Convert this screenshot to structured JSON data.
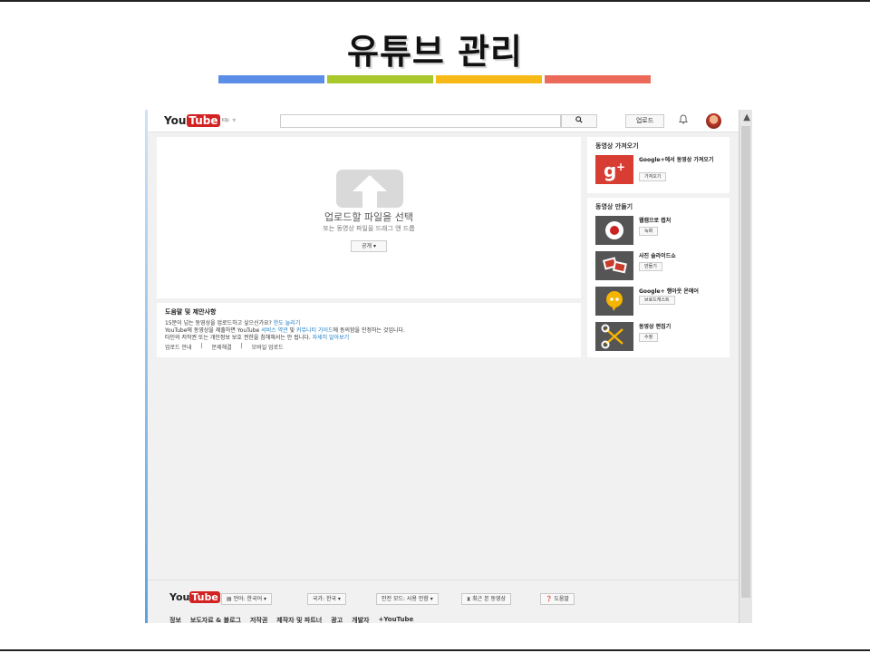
{
  "slide": {
    "title": "유튜브 관리",
    "bar_colors": [
      "#5b8ee6",
      "#a8c82c",
      "#f6b916",
      "#ec6a5a"
    ]
  },
  "masthead": {
    "logo_you": "You",
    "logo_tube": "Tube",
    "logo_region": "KR",
    "search_icon": "search-icon",
    "upload_label": "업로드"
  },
  "upload": {
    "title": "업로드할 파일을 선택",
    "subtitle": "또는 동영상 파일을 드래그 앤 드롭",
    "privacy_label": "공개 ▾"
  },
  "help": {
    "title": "도움말 및 제안사항",
    "line1_text": "15분이 넘는 동영상을 업로드하고 싶으신가요? ",
    "line1_link": "한도 늘리기",
    "line2_a": "YouTube에 동영상을 제출하면 YouTube ",
    "line2_link1": "서비스 약관",
    "line2_b": " 및 ",
    "line2_link2": "커뮤니티 가이드",
    "line2_c": "에 동의함을 인정하는 것입니다.",
    "line3_text": "타인의 저작권 또는 개인정보 보호 권한을 침해해서는 안 됩니다. ",
    "line3_link": "자세히 알아보기",
    "links": [
      "업로드 안내",
      "|",
      "문제해결",
      "|",
      "모바일 업로드"
    ]
  },
  "import_card": {
    "heading": "동영상 가져오기",
    "item_label": "Google+에서 동영상 가져오기",
    "item_button": "가져오기"
  },
  "create_card": {
    "heading": "동영상 만들기",
    "items": [
      {
        "label": "웹캠으로 캡처",
        "button": "녹화"
      },
      {
        "label": "사진 슬라이드쇼",
        "button": "만들기"
      },
      {
        "label": "Google+ 행아웃 온에어",
        "button": "브로드캐스트"
      },
      {
        "label": "동영상 편집기",
        "button": "수정"
      }
    ]
  },
  "footer": {
    "logo_you": "You",
    "logo_tube": "Tube",
    "language": "언어: 한국어 ▾",
    "country": "국가: 한국 ▾",
    "safety": "안전 모드: 사용 안함 ▾",
    "history": "최근 본 동영상",
    "help": "도움말",
    "links": [
      "정보",
      "보도자료 & 블로그",
      "저작권",
      "제작자 및 파트너",
      "광고",
      "개발자",
      "+YouTube"
    ]
  }
}
